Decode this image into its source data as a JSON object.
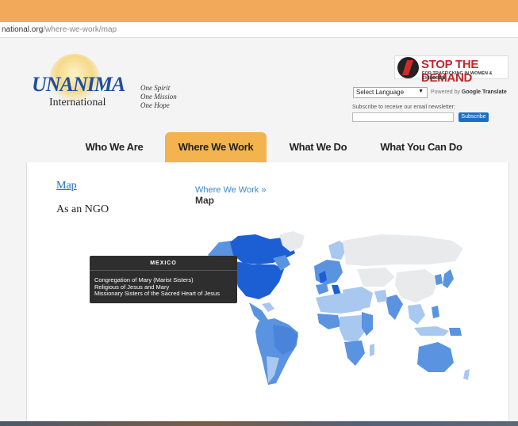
{
  "browser": {
    "address_host": "national.org",
    "address_path": "/where-we-work/map"
  },
  "header": {
    "logo_main": "UNANIMA",
    "logo_sub": "International",
    "tagline": [
      "One Spirit",
      "One Mission",
      "One Hope"
    ],
    "stop_demand_title": "STOP THE DEMAND",
    "stop_demand_sub": "FOR TRAFFICKING IN WOMEN & CHILDREN",
    "language_select": "Select Language",
    "powered_by": "Powered by",
    "powered_google": "Google",
    "powered_translate": "Translate",
    "subscribe_label": "Subscribe to receive our email newsletter:",
    "subscribe_button": "Subscribe"
  },
  "nav": {
    "items": [
      {
        "label": "Who We Are",
        "active": false
      },
      {
        "label": "Where We Work",
        "active": true
      },
      {
        "label": "What We Do",
        "active": false
      },
      {
        "label": "What You Can Do",
        "active": false
      }
    ]
  },
  "sidebar": {
    "map_link": "Map",
    "ngo_link": "As an NGO"
  },
  "main": {
    "breadcrumb": "Where We Work  »",
    "title": "Map"
  },
  "map": {
    "colors": {
      "high": "#1c5fd4",
      "mid": "#5a93e0",
      "low": "#a9c8ef",
      "none": "#e9eaeb"
    }
  },
  "tooltip": {
    "country": "MEXICO",
    "items": [
      "Congregation of Mary (Marist Sisters)",
      "Religious of Jesus and Mary",
      "Missionary Sisters of the Sacred Heart of Jesus"
    ]
  }
}
